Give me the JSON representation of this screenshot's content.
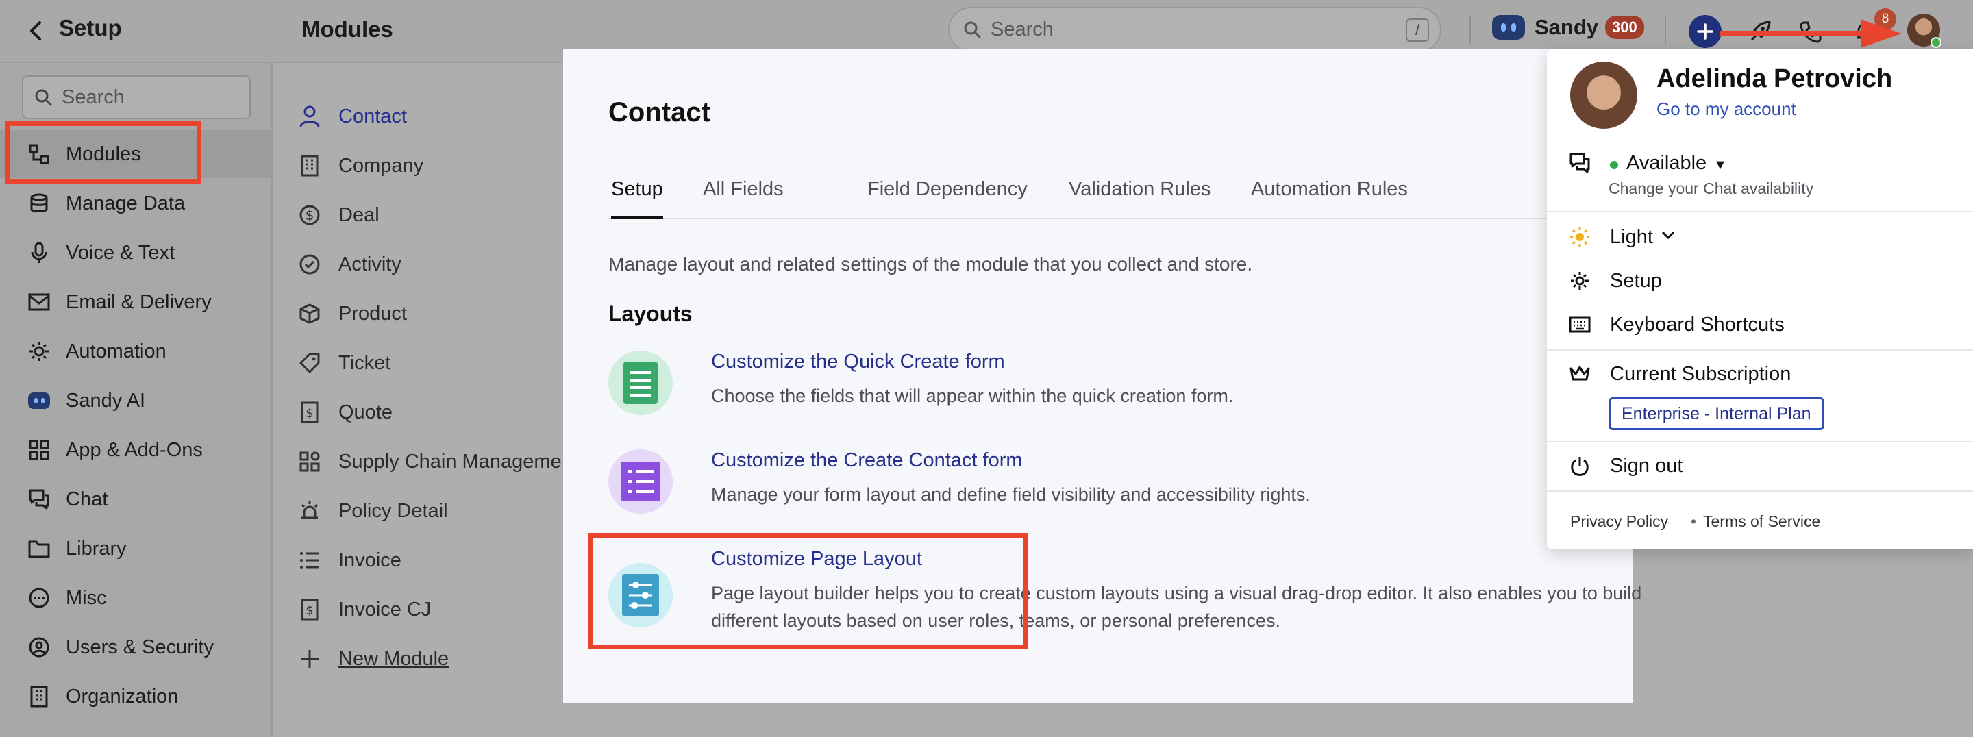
{
  "header": {
    "setup_title": "Setup",
    "modules_title": "Modules",
    "search_placeholder": "Search",
    "search_shortcut": "/",
    "assistant_name": "Sandy",
    "assistant_count": "300",
    "notification_count": "8"
  },
  "sidebar": {
    "search_placeholder": "Search",
    "items": [
      {
        "label": "Modules",
        "icon": "modules-icon",
        "active": true
      },
      {
        "label": "Manage Data",
        "icon": "database-icon"
      },
      {
        "label": "Voice & Text",
        "icon": "microphone-icon"
      },
      {
        "label": "Email & Delivery",
        "icon": "envelope-icon"
      },
      {
        "label": "Automation",
        "icon": "automation-icon"
      },
      {
        "label": "Sandy AI",
        "icon": "sandy-ai-icon"
      },
      {
        "label": "App & Add-Ons",
        "icon": "apps-grid-icon"
      },
      {
        "label": "Chat",
        "icon": "chat-icon"
      },
      {
        "label": "Library",
        "icon": "folder-icon"
      },
      {
        "label": "Misc",
        "icon": "more-circle-icon"
      },
      {
        "label": "Users & Security",
        "icon": "user-circle-icon"
      },
      {
        "label": "Organization",
        "icon": "building-icon"
      }
    ]
  },
  "modules_list": {
    "items": [
      {
        "label": "Contact",
        "icon": "person-icon",
        "active": true
      },
      {
        "label": "Company",
        "icon": "building-icon"
      },
      {
        "label": "Deal",
        "icon": "dollar-circle-icon"
      },
      {
        "label": "Activity",
        "icon": "check-circle-icon"
      },
      {
        "label": "Product",
        "icon": "box-icon"
      },
      {
        "label": "Ticket",
        "icon": "tag-icon"
      },
      {
        "label": "Quote",
        "icon": "dollar-doc-icon"
      },
      {
        "label": "Supply Chain Manageme...",
        "icon": "widgets-icon"
      },
      {
        "label": "Policy Detail",
        "icon": "alarm-icon"
      },
      {
        "label": "Invoice",
        "icon": "list-icon"
      },
      {
        "label": "Invoice CJ",
        "icon": "dollar-doc-icon"
      }
    ],
    "new_module": "New Module"
  },
  "content": {
    "title": "Contact",
    "tabs": [
      "Setup",
      "All Fields",
      "Field Dependency",
      "Validation Rules",
      "Automation Rules"
    ],
    "active_tab": "Setup",
    "description": "Manage layout and related settings of the module that you collect and store.",
    "layouts_heading": "Layouts",
    "layouts": [
      {
        "title": "Customize the Quick Create form",
        "desc": "Choose the fields that will appear within the quick creation form.",
        "icon": "form-icon",
        "color": "#3aa86b"
      },
      {
        "title": "Customize the Create Contact form",
        "desc": "Manage your form layout and define field visibility and accessibility rights.",
        "icon": "form-list-icon",
        "color": "#8c4fe0"
      },
      {
        "title": "Customize Page Layout",
        "desc": "Page layout builder helps you to create custom layouts using a visual drag-drop editor. It also enables you to build different layouts based on user roles, teams, or personal preferences.",
        "icon": "sliders-icon",
        "color": "#3d9fc8"
      }
    ]
  },
  "profile_menu": {
    "name": "Adelinda Petrovich",
    "account_link": "Go to my account",
    "availability": "Available",
    "availability_sub": "Change your Chat availability",
    "theme": "Light",
    "setup": "Setup",
    "keyboard_shortcuts": "Keyboard Shortcuts",
    "subscription": "Current Subscription",
    "plan": "Enterprise - Internal Plan",
    "sign_out": "Sign out",
    "privacy": "Privacy Policy",
    "separator": "•",
    "terms": "Terms of Service"
  },
  "colors": {
    "highlight": "#e8442e",
    "link": "#2e4fb8",
    "accent_navy": "#21307a"
  }
}
